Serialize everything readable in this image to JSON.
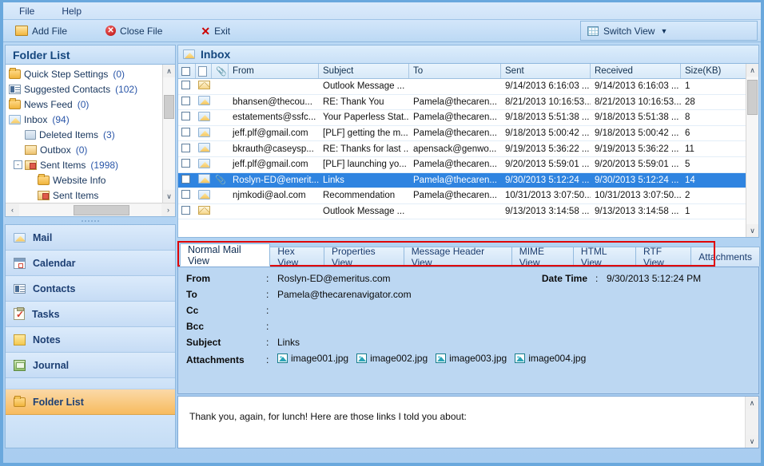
{
  "menu": {
    "items": [
      "File",
      "Help"
    ]
  },
  "toolbar": {
    "add_file": "Add File",
    "close_file": "Close File",
    "exit": "Exit",
    "switch_view": "Switch View"
  },
  "sidebar": {
    "title": "Folder List",
    "tree": [
      {
        "label": "Quick Step Settings",
        "count": "(0)",
        "icon": "folder-icon",
        "indent": 0,
        "expander": ""
      },
      {
        "label": "Suggested Contacts",
        "count": "(102)",
        "icon": "contact-card-icon",
        "indent": 0,
        "expander": ""
      },
      {
        "label": "News Feed",
        "count": "(0)",
        "icon": "folder-icon",
        "indent": 0,
        "expander": ""
      },
      {
        "label": "Inbox",
        "count": "(94)",
        "icon": "inbox-folder-icon",
        "indent": 0,
        "expander": ""
      },
      {
        "label": "Deleted Items",
        "count": "(3)",
        "icon": "trash-icon",
        "indent": 1,
        "expander": ""
      },
      {
        "label": "Outbox",
        "count": "(0)",
        "icon": "outbox-icon",
        "indent": 1,
        "expander": ""
      },
      {
        "label": "Sent Items",
        "count": "(1998)",
        "icon": "sent-items-icon",
        "indent": 1,
        "expander": "-"
      },
      {
        "label": "Website Info",
        "count": "",
        "icon": "folder-icon",
        "indent": 2,
        "expander": ""
      },
      {
        "label": "Sent Items",
        "count": "",
        "icon": "sent-items-icon",
        "indent": 2,
        "expander": ""
      }
    ],
    "nav": [
      {
        "label": "Mail",
        "icon": "mail-icon",
        "selected": false
      },
      {
        "label": "Calendar",
        "icon": "calendar-icon",
        "selected": false
      },
      {
        "label": "Contacts",
        "icon": "contacts-icon",
        "selected": false
      },
      {
        "label": "Tasks",
        "icon": "tasks-icon",
        "selected": false
      },
      {
        "label": "Notes",
        "icon": "notes-icon",
        "selected": false
      },
      {
        "label": "Journal",
        "icon": "journal-icon",
        "selected": false
      },
      {
        "label": "Folder List",
        "icon": "folder-icon",
        "selected": true
      }
    ]
  },
  "list": {
    "header_title": "Inbox",
    "columns": [
      "From",
      "Subject",
      "To",
      "Sent",
      "Received",
      "Size(KB)"
    ],
    "rows": [
      {
        "read": true,
        "attach": false,
        "from": "",
        "subject": "Outlook Message ...",
        "to": "",
        "sent": "9/14/2013 6:16:03 ...",
        "received": "9/14/2013 6:16:03 ...",
        "size": "1",
        "selected": false
      },
      {
        "read": false,
        "attach": false,
        "from": "bhansen@thecou...",
        "subject": "RE: Thank You",
        "to": "Pamela@thecaren...",
        "sent": "8/21/2013 10:16:53...",
        "received": "8/21/2013 10:16:53...",
        "size": "28",
        "selected": false
      },
      {
        "read": false,
        "attach": false,
        "from": "estatements@ssfc...",
        "subject": "Your Paperless Stat...",
        "to": "Pamela@thecaren...",
        "sent": "9/18/2013 5:51:38 ...",
        "received": "9/18/2013 5:51:38 ...",
        "size": "8",
        "selected": false
      },
      {
        "read": false,
        "attach": false,
        "from": "jeff.plf@gmail.com",
        "subject": "[PLF] getting the m...",
        "to": "Pamela@thecaren...",
        "sent": "9/18/2013 5:00:42 ...",
        "received": "9/18/2013 5:00:42 ...",
        "size": "6",
        "selected": false
      },
      {
        "read": false,
        "attach": false,
        "from": "bkrauth@caseysp...",
        "subject": "RE: Thanks for last ...",
        "to": "apensack@genwo...",
        "sent": "9/19/2013 5:36:22 ...",
        "received": "9/19/2013 5:36:22 ...",
        "size": "11",
        "selected": false
      },
      {
        "read": false,
        "attach": false,
        "from": "jeff.plf@gmail.com",
        "subject": "[PLF] launching yo...",
        "to": "Pamela@thecaren...",
        "sent": "9/20/2013 5:59:01 ...",
        "received": "9/20/2013 5:59:01 ...",
        "size": "5",
        "selected": false
      },
      {
        "read": false,
        "attach": true,
        "from": "Roslyn-ED@emerit...",
        "subject": "Links",
        "to": "Pamela@thecaren...",
        "sent": "9/30/2013 5:12:24 ...",
        "received": "9/30/2013 5:12:24 ...",
        "size": "14",
        "selected": true
      },
      {
        "read": false,
        "attach": false,
        "from": "njmkodi@aol.com",
        "subject": "Recommendation",
        "to": "Pamela@thecaren...",
        "sent": "10/31/2013 3:07:50...",
        "received": "10/31/2013 3:07:50...",
        "size": "2",
        "selected": false
      },
      {
        "read": true,
        "attach": false,
        "from": "",
        "subject": "Outlook Message ...",
        "to": "",
        "sent": "9/13/2013 3:14:58 ...",
        "received": "9/13/2013 3:14:58 ...",
        "size": "1",
        "selected": false
      }
    ]
  },
  "tabs": {
    "items": [
      {
        "label": "Normal Mail View",
        "active": true
      },
      {
        "label": "Hex View",
        "active": false
      },
      {
        "label": "Properties View",
        "active": false
      },
      {
        "label": "Message Header View",
        "active": false
      },
      {
        "label": "MIME View",
        "active": false
      },
      {
        "label": "HTML View",
        "active": false
      },
      {
        "label": "RTF View",
        "active": false
      },
      {
        "label": "Attachments",
        "active": false
      }
    ],
    "highlight_color": "#e00000"
  },
  "detail": {
    "labels": {
      "from": "From",
      "to": "To",
      "cc": "Cc",
      "bcc": "Bcc",
      "subject": "Subject",
      "attachments": "Attachments",
      "date_time": "Date Time"
    },
    "colon": ":",
    "values": {
      "from": "Roslyn-ED@emeritus.com",
      "to": "Pamela@thecarenavigator.com",
      "cc": "",
      "bcc": "",
      "subject": "Links",
      "date_time": "9/30/2013 5:12:24 PM"
    },
    "attachments": [
      "image001.jpg",
      "image002.jpg",
      "image003.jpg",
      "image004.jpg"
    ]
  },
  "message_body": "Thank you, again, for lunch!  Here are those links I told you about:",
  "scroll": {
    "up": "∧",
    "down": "∨",
    "left": "‹",
    "right": "›"
  }
}
